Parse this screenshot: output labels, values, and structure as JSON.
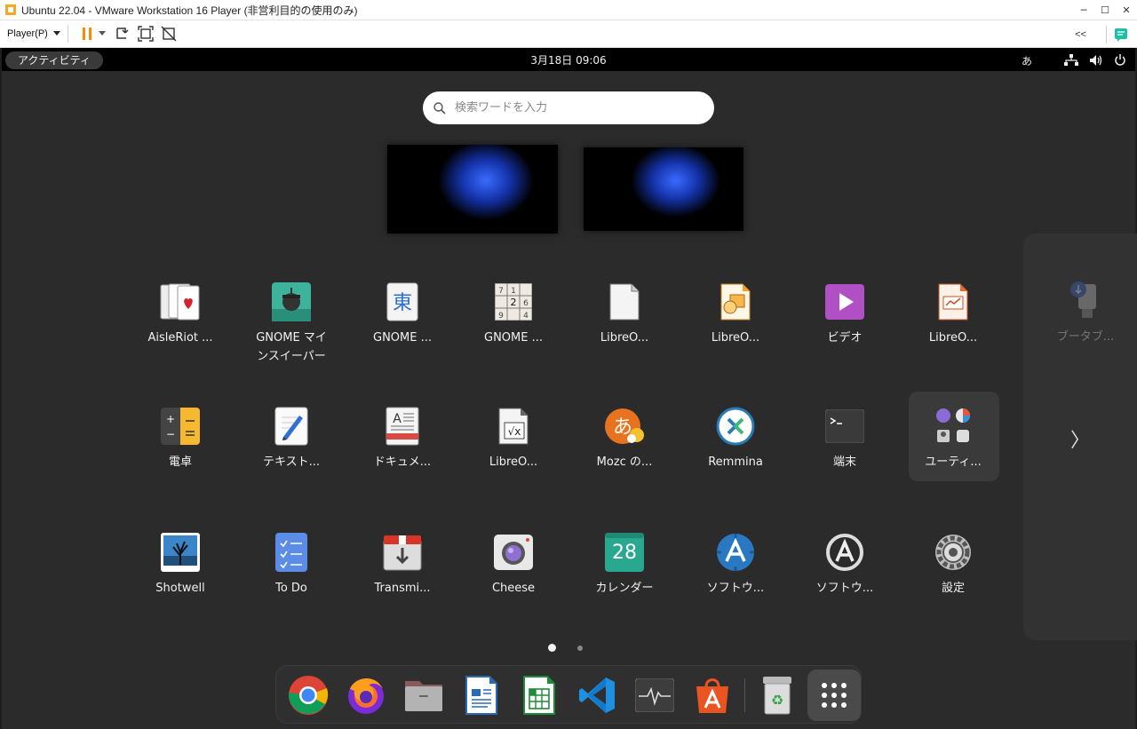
{
  "window": {
    "title": "Ubuntu 22.04 - VMware Workstation 16 Player (非営利目的の使用のみ)",
    "minimize": "─",
    "maximize": "☐",
    "close": "✕"
  },
  "vm_toolbar": {
    "player_menu": "Player(P)",
    "collapse_label": "<<"
  },
  "topbar": {
    "activities": "アクティビティ",
    "clock": "3月18日  09:06",
    "input_method": "あ"
  },
  "search": {
    "placeholder": "検索ワードを入力"
  },
  "apps": [
    {
      "label": "AisleRiot ...",
      "icon": "cards-icon"
    },
    {
      "label": "GNOME マインスイーパー",
      "icon": "mines-icon"
    },
    {
      "label": "GNOME ...",
      "icon": "mahjongg-icon"
    },
    {
      "label": "GNOME ...",
      "icon": "sudoku-icon"
    },
    {
      "label": "LibreO...",
      "icon": "libreoffice-icon"
    },
    {
      "label": "LibreO...",
      "icon": "libreoffice-draw-icon"
    },
    {
      "label": "ビデオ",
      "icon": "video-icon"
    },
    {
      "label": "LibreO...",
      "icon": "libreoffice-impress-icon"
    },
    {
      "label": "電卓",
      "icon": "calculator-icon"
    },
    {
      "label": "テキスト...",
      "icon": "text-editor-icon"
    },
    {
      "label": "ドキュメ...",
      "icon": "document-viewer-icon"
    },
    {
      "label": "LibreO...",
      "icon": "libreoffice-math-icon"
    },
    {
      "label": "Mozc の...",
      "icon": "mozc-icon"
    },
    {
      "label": "Remmina",
      "icon": "remmina-icon"
    },
    {
      "label": "端末",
      "icon": "terminal-icon"
    },
    {
      "label": "ユーティ...",
      "icon": "utilities-folder-icon"
    },
    {
      "label": "Shotwell",
      "icon": "shotwell-icon"
    },
    {
      "label": "To Do",
      "icon": "todo-icon"
    },
    {
      "label": "Transmi...",
      "icon": "transmission-icon"
    },
    {
      "label": "Cheese",
      "icon": "cheese-icon"
    },
    {
      "label": "カレンダー",
      "icon": "calendar-icon"
    },
    {
      "label": "ソフトウ...",
      "icon": "software-icon"
    },
    {
      "label": "ソフトウ...",
      "icon": "software-updater-icon"
    },
    {
      "label": "設定",
      "icon": "settings-icon"
    }
  ],
  "calendar_day": "28",
  "next_page_app": {
    "label": "ブータブ...",
    "icon": "usb-creator-icon"
  },
  "next_chevron": "〉",
  "pagination": {
    "current": 1,
    "total": 2
  },
  "dock": [
    {
      "name": "chrome",
      "icon": "chrome-icon"
    },
    {
      "name": "firefox",
      "icon": "firefox-icon"
    },
    {
      "name": "files",
      "icon": "files-icon"
    },
    {
      "name": "libreoffice-writer",
      "icon": "writer-icon"
    },
    {
      "name": "libreoffice-calc",
      "icon": "calc-icon"
    },
    {
      "name": "vscode",
      "icon": "vscode-icon"
    },
    {
      "name": "system-monitor",
      "icon": "system-monitor-icon"
    },
    {
      "name": "software-center",
      "icon": "software-center-icon"
    },
    {
      "name": "trash",
      "icon": "trash-icon"
    },
    {
      "name": "show-apps",
      "icon": "grid-icon"
    }
  ],
  "colors": {
    "bg": "#2b2b2b",
    "topbar": "#000000",
    "accent": "#e95420",
    "pause": "#ff8a00"
  }
}
